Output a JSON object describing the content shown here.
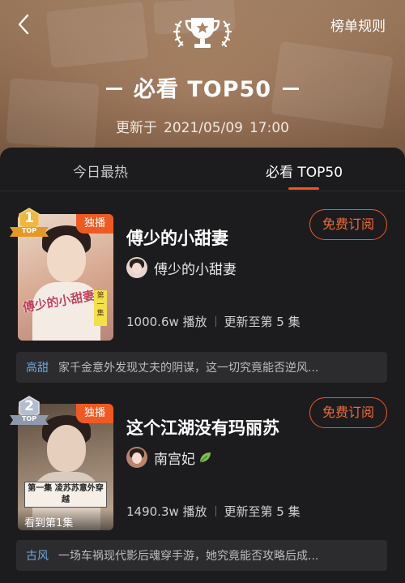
{
  "header": {
    "rules_label": "榜单规则",
    "title": "必看 TOP50",
    "updated_label": "更新于",
    "updated_date": "2021/05/09",
    "updated_time": "17:00"
  },
  "tabs": [
    {
      "label": "今日最热",
      "active": false
    },
    {
      "label": "必看 TOP50",
      "active": true
    }
  ],
  "colors": {
    "accent": "#f2551e",
    "tag": "#6fa7dc",
    "gold": "#e8b33a",
    "silver": "#a9b3c2"
  },
  "items": [
    {
      "rank": "1",
      "rank_ribbon": "TOP",
      "exclusive_label": "独播",
      "title": "傅少的小甜妻",
      "author": "傅少的小甜妻",
      "plays": "1000.6w 播放",
      "update": "更新至第 5 集",
      "subscribe_label": "免费订阅",
      "tag": "高甜",
      "synopsis": "家千金意外发现丈夫的阴谋，这一切究竟能否逆风...",
      "poster_script": "傅少的小甜妻",
      "poster_episode": "第一集"
    },
    {
      "rank": "2",
      "rank_ribbon": "TOP",
      "exclusive_label": "独播",
      "title": "这个江湖没有玛丽苏",
      "author": "南宫妃",
      "plays": "1490.3w 播放",
      "update": "更新至第 5 集",
      "subscribe_label": "免费订阅",
      "tag": "古风",
      "synopsis": "一场车祸现代影后魂穿手游，她究竟能否攻略后成...",
      "poster_caption": "第一集 凌苏苏意外穿越",
      "watched_label": "看到第1集"
    }
  ]
}
